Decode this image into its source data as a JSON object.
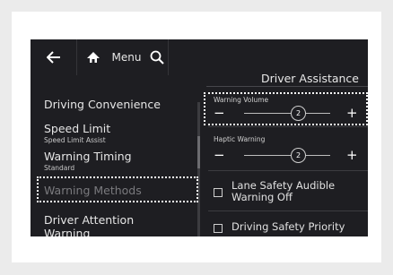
{
  "topbar": {
    "back_icon": "back-arrow-icon",
    "home_icon": "home-icon",
    "menu_label": "Menu",
    "search_icon": "search-icon",
    "page_title": "Driver Assistance"
  },
  "menu_list": [
    {
      "label": "Driving Convenience",
      "sub": ""
    },
    {
      "label": "Speed Limit",
      "sub": "Speed Limit Assist"
    },
    {
      "label": "Warning Timing",
      "sub": "Standard"
    },
    {
      "label": "Warning Methods",
      "sub": ""
    },
    {
      "label": "Driver Attention Warning",
      "sub": ""
    }
  ],
  "settings": {
    "warning_volume": {
      "label": "Warning Volume",
      "value": "2",
      "minus": "−",
      "plus": "+"
    },
    "haptic_warning": {
      "label": "Haptic Warning",
      "value": "2",
      "minus": "−",
      "plus": "+"
    },
    "lane_safety": {
      "label": "Lane Safety Audible Warning Off",
      "checked": false
    },
    "driving_safety": {
      "label": "Driving Safety Priority",
      "checked": false
    }
  },
  "colors": {
    "screen_bg": "#1e1e22",
    "text": "#e6e6e6",
    "highlight": "#ffffff",
    "outer_bg": "#ebebeb"
  }
}
